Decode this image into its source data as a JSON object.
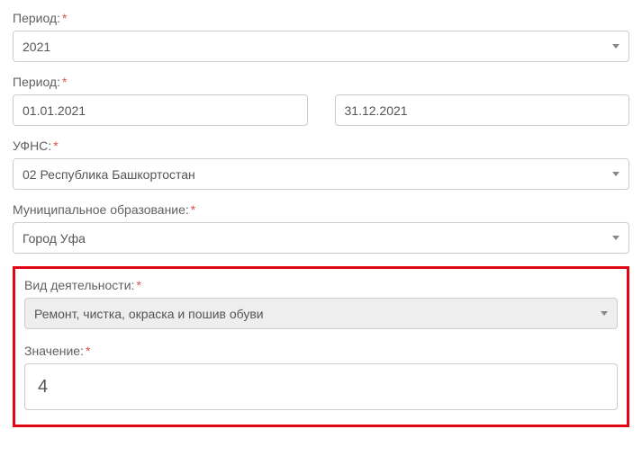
{
  "period_year": {
    "label": "Период:",
    "value": "2021"
  },
  "period_range": {
    "label": "Период:",
    "from": "01.01.2021",
    "to": "31.12.2021"
  },
  "ufns": {
    "label": "УФНС:",
    "value": "02 Республика Башкортостан"
  },
  "municipality": {
    "label": "Муниципальное образование:",
    "value": "Город Уфа"
  },
  "activity": {
    "label": "Вид деятельности:",
    "value": "Ремонт, чистка, окраска и пошив обуви"
  },
  "value_field": {
    "label": "Значение:",
    "value": "4"
  },
  "required_marker": "*"
}
